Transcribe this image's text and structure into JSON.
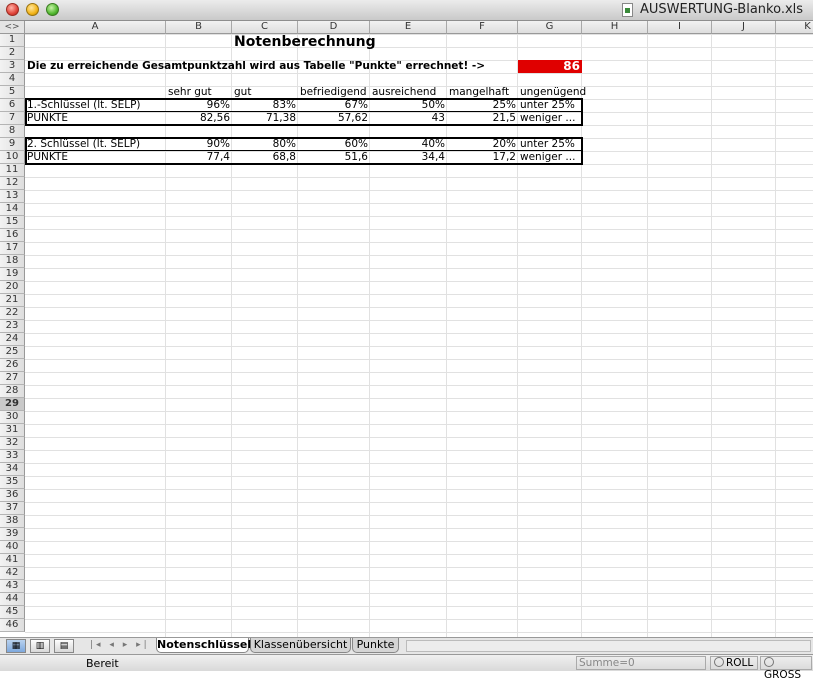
{
  "window": {
    "title": "AUSWERTUNG-Blanko.xls"
  },
  "grid": {
    "corner": "<>",
    "columns": [
      "A",
      "B",
      "C",
      "D",
      "E",
      "F",
      "G",
      "H",
      "I",
      "J",
      "K"
    ],
    "rows": [
      "1",
      "2",
      "3",
      "4",
      "5",
      "6",
      "7",
      "8",
      "9",
      "10",
      "11",
      "12",
      "13",
      "14",
      "15",
      "16",
      "17",
      "18",
      "19",
      "20",
      "21",
      "22",
      "23",
      "24",
      "25",
      "26",
      "27",
      "28",
      "29",
      "30",
      "31",
      "32",
      "33",
      "34",
      "35",
      "36",
      "37",
      "38",
      "39",
      "40",
      "41",
      "42",
      "43",
      "44",
      "45",
      "46"
    ],
    "selected_row": "29"
  },
  "sheet": {
    "title": "Notenberechnung",
    "row3_label": "Die zu erreichende Gesamtpunktzahl wird aus Tabelle \"Punkte\" errechnet! ->",
    "total_points": "86",
    "grade_headers": [
      "sehr gut",
      "gut",
      "befriedigend",
      "ausreichend",
      "mangelhaft",
      "ungenügend"
    ],
    "key1": {
      "label": "1.-Schlüssel (lt. SELP)",
      "percents": [
        "96%",
        "83%",
        "67%",
        "50%",
        "25%"
      ],
      "last": "unter 25%",
      "points_label": "PUNKTE",
      "points": [
        "82,56",
        "71,38",
        "57,62",
        "43",
        "21,5"
      ],
      "points_last": "weniger ..."
    },
    "key2": {
      "label": "2. Schlüssel (lt. SELP)",
      "percents": [
        "90%",
        "80%",
        "60%",
        "40%",
        "20%"
      ],
      "last": "unter 25%",
      "points_label": "PUNKTE",
      "points": [
        "77,4",
        "68,8",
        "51,6",
        "34,4",
        "17,2"
      ],
      "points_last": "weniger ..."
    }
  },
  "tabs": [
    {
      "label": "Notenschlüssel",
      "active": true
    },
    {
      "label": "Klassenübersicht",
      "active": false
    },
    {
      "label": "Punkte",
      "active": false
    }
  ],
  "tab_nav": "|◂ ◂ ▸ ▸|",
  "status": {
    "text": "Bereit",
    "sum": "Summe=0",
    "roll": "ROLL",
    "gross": "GROSS"
  },
  "colors": {
    "accent_red": "#e00000"
  }
}
